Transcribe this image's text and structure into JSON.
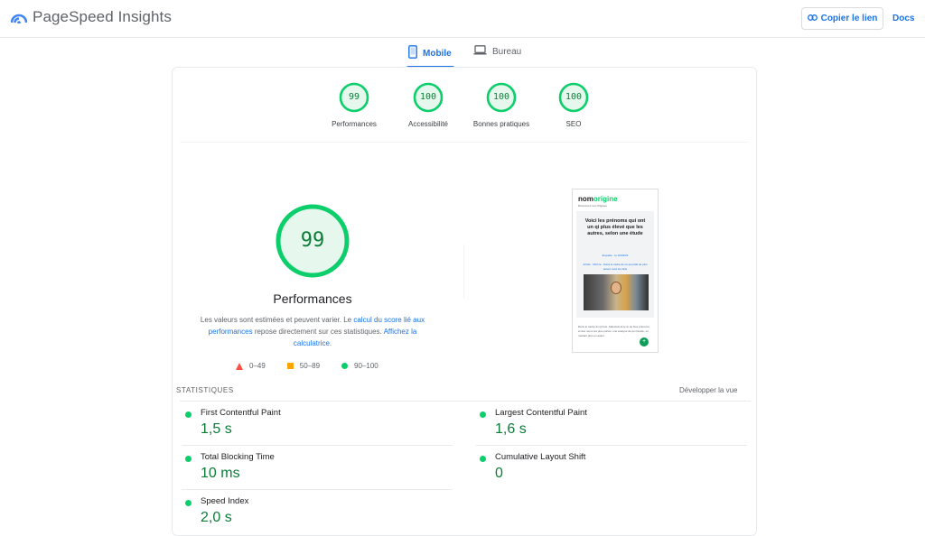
{
  "header": {
    "app_title": "PageSpeed Insights",
    "copy_link_label": "Copier le lien",
    "docs_label": "Docs",
    "logo_icon": "pagespeed-logo-icon",
    "link_icon": "link-icon"
  },
  "tabs": [
    {
      "label": "Mobile",
      "icon": "mobile-phone-icon",
      "selected": true
    },
    {
      "label": "Bureau",
      "icon": "laptop-icon",
      "selected": false
    }
  ],
  "scores": [
    {
      "label": "Performances",
      "value": "99"
    },
    {
      "label": "Accessibilité",
      "value": "100"
    },
    {
      "label": "Bonnes pratiques",
      "value": "100"
    },
    {
      "label": "SEO",
      "value": "100"
    }
  ],
  "performance": {
    "score": "99",
    "title": "Performances",
    "desc_part1": "Les valeurs sont estimées et peuvent varier. Le ",
    "desc_link1": "calcul du score lié aux performances",
    "desc_part2": " repose directement sur ces statistiques. ",
    "desc_link2": "Affichez la calculatrice",
    "desc_part3": "."
  },
  "legend": [
    {
      "label": "0–49",
      "color": "#ff4e42"
    },
    {
      "label": "50–89",
      "color": "#ffa400"
    },
    {
      "label": "90–100",
      "color": "#0cce6b"
    }
  ],
  "screenshot": {
    "logo_part1": "nom",
    "logo_part2": "origine",
    "tagline": "Découvrez vos Origines",
    "headline": "Voici les prénoms qui ont un qi plus élevé que les autres, selon une étude",
    "meta1": "Enquête · le 10/04/23",
    "meta2": "Article · MAJ le · Dans le cadre de ce qui plaît de plus auteur suivi les faits",
    "body": "Dans le cadre du Qi test. Sélectionné le qi de Nos prénoms et des noms les plus portés, une analyse de qui l'étude, en mettant plus en avant",
    "fab": "+"
  },
  "statistics": {
    "heading": "STATISTIQUES",
    "expand_label": "Développer la vue",
    "metrics": [
      {
        "name": "First Contentful Paint",
        "value": "1,5 s"
      },
      {
        "name": "Largest Contentful Paint",
        "value": "1,6 s"
      },
      {
        "name": "Total Blocking Time",
        "value": "10 ms"
      },
      {
        "name": "Cumulative Layout Shift",
        "value": "0"
      },
      {
        "name": "Speed Index",
        "value": "2,0 s"
      }
    ]
  },
  "colors": {
    "accent": "#1a73e8",
    "pass": "#0cce6b",
    "pass_text": "#0c7c37",
    "average": "#ffa400",
    "fail": "#ff4e42"
  }
}
